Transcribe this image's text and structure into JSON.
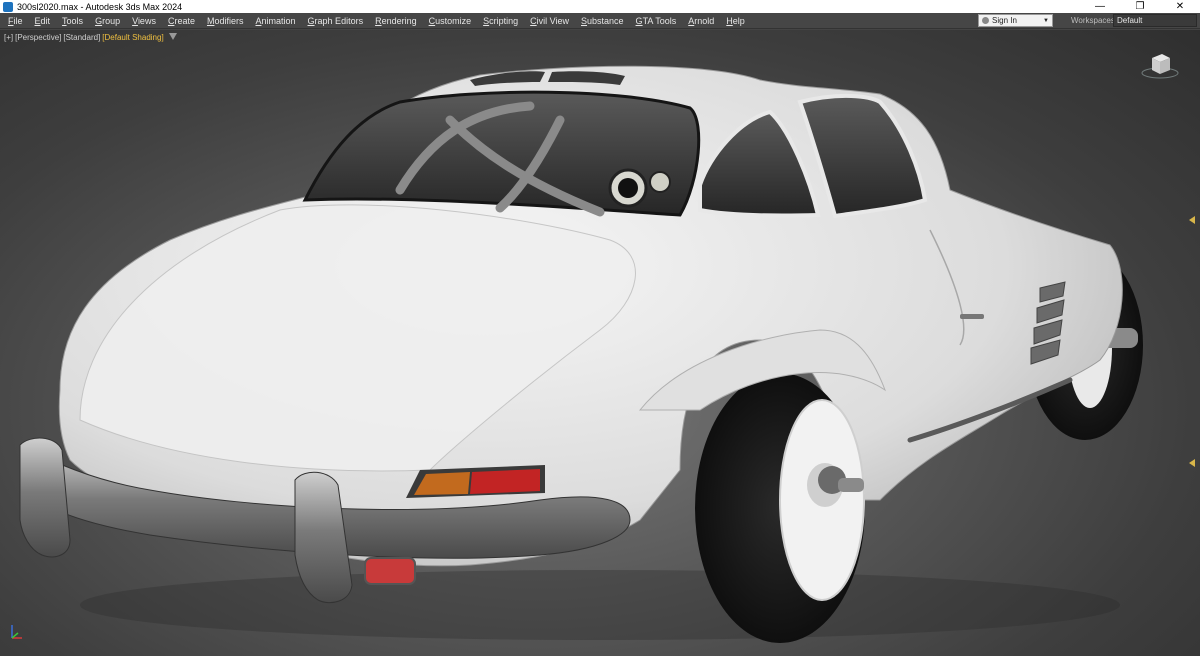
{
  "titlebar": {
    "title": "300sl2020.max - Autodesk 3ds Max 2024",
    "minimize": "—",
    "restore": "❐",
    "close": "✕"
  },
  "menu": [
    "File",
    "Edit",
    "Tools",
    "Group",
    "Views",
    "Create",
    "Modifiers",
    "Animation",
    "Graph Editors",
    "Rendering",
    "Customize",
    "Scripting",
    "Civil View",
    "Substance",
    "GTA Tools",
    "Arnold",
    "Help"
  ],
  "signin": {
    "label": "Sign In"
  },
  "workspaces": {
    "label": "Workspaces:",
    "value": "Default"
  },
  "viewport": {
    "menu": "[+]",
    "view": "[Perspective]",
    "quality": "[Standard]",
    "shading": "[Default Shading]"
  },
  "colors": {
    "accent": "#f0c040",
    "menubar": "#464646",
    "viewport_bg": "#555555"
  }
}
